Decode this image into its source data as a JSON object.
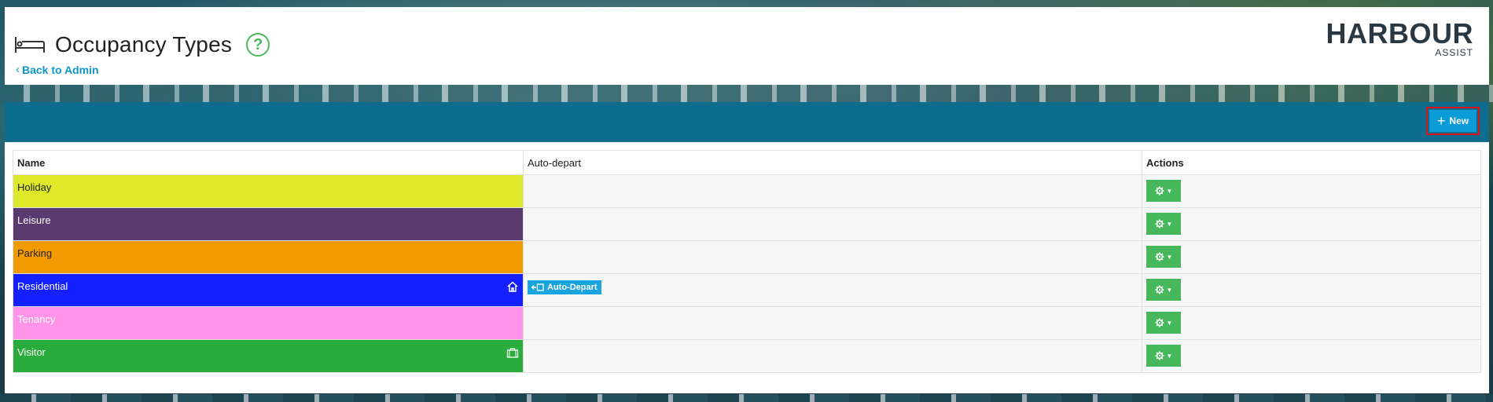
{
  "header": {
    "title": "Occupancy Types",
    "help_icon": "help-circle-icon",
    "back_label": "Back to Admin",
    "logo_main": "HARBOUR",
    "logo_sub": "ASSIST"
  },
  "toolbar": {
    "new_label": "New"
  },
  "table": {
    "columns": [
      "Name",
      "Auto-depart",
      "Actions"
    ],
    "rows": [
      {
        "name": "Holiday",
        "color": "#dde928",
        "text_color": "#222222",
        "icon": "",
        "auto_depart": ""
      },
      {
        "name": "Leisure",
        "color": "#593a6e",
        "text_color": "#ffffff",
        "icon": "",
        "auto_depart": ""
      },
      {
        "name": "Parking",
        "color": "#f29b00",
        "text_color": "#222222",
        "icon": "",
        "auto_depart": ""
      },
      {
        "name": "Residential",
        "color": "#1420ff",
        "text_color": "#ffffff",
        "icon": "home-icon",
        "auto_depart": "Auto-Depart"
      },
      {
        "name": "Tenancy",
        "color": "#ff94e8",
        "text_color": "#ffffff",
        "icon": "",
        "auto_depart": ""
      },
      {
        "name": "Visitor",
        "color": "#29ac3c",
        "text_color": "#ffffff",
        "icon": "briefcase-icon",
        "auto_depart": ""
      }
    ]
  },
  "colors": {
    "panel_bar": "#0e6d8e",
    "new_button": "#0b9bd7",
    "action_button": "#46b75b",
    "link": "#0d97c9",
    "badge": "#19a4dd"
  }
}
